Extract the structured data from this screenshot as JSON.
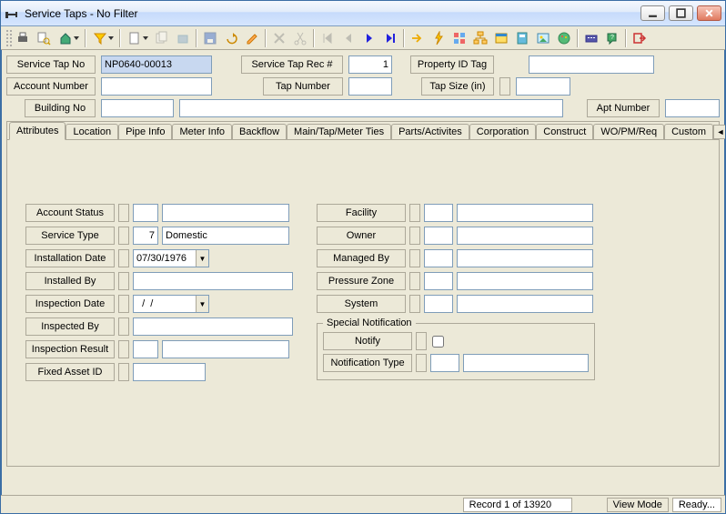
{
  "window": {
    "title": "Service Taps - No Filter"
  },
  "toprow": {
    "service_tap_no_label": "Service Tap No",
    "service_tap_no_value": "NP0640-00013",
    "service_tap_rec_label": "Service Tap Rec #",
    "service_tap_rec_value": "1",
    "property_id_tag_label": "Property ID Tag",
    "property_id_tag_value": "",
    "account_number_label": "Account Number",
    "account_number_value": "",
    "tap_number_label": "Tap Number",
    "tap_number_value": "",
    "tap_size_label": "Tap Size (in)",
    "tap_size_value": "",
    "building_no_label": "Building No",
    "building_no_value": "",
    "building_desc_value": "",
    "apt_number_label": "Apt Number",
    "apt_number_value": ""
  },
  "tabs": {
    "items": [
      "Attributes",
      "Location",
      "Pipe Info",
      "Meter Info",
      "Backflow",
      "Main/Tap/Meter Ties",
      "Parts/Activites",
      "Corporation",
      "Construct",
      "WO/PM/Req",
      "Custom"
    ],
    "active_index": 0
  },
  "attributes": {
    "account_status_label": "Account Status",
    "account_status_code": "",
    "account_status_desc": "",
    "service_type_label": "Service Type",
    "service_type_code": "7",
    "service_type_desc": "Domestic",
    "installation_date_label": "Installation Date",
    "installation_date_value": "07/30/1976",
    "installed_by_label": "Installed By",
    "installed_by_value": "",
    "inspection_date_label": "Inspection Date",
    "inspection_date_value": "  /  /",
    "inspected_by_label": "Inspected By",
    "inspected_by_value": "",
    "inspection_result_label": "Inspection Result",
    "inspection_result_code": "",
    "inspection_result_desc": "",
    "fixed_asset_id_label": "Fixed Asset ID",
    "fixed_asset_id_value": "",
    "facility_label": "Facility",
    "facility_code": "",
    "facility_desc": "",
    "owner_label": "Owner",
    "owner_code": "",
    "owner_desc": "",
    "managed_by_label": "Managed By",
    "managed_by_code": "",
    "managed_by_desc": "",
    "pressure_zone_label": "Pressure Zone",
    "pressure_zone_code": "",
    "pressure_zone_desc": "",
    "system_label": "System",
    "system_code": "",
    "system_desc": "",
    "special_legend": "Special Notification",
    "notify_label": "Notify",
    "notify_checked": false,
    "notification_type_label": "Notification Type",
    "notification_type_code": "",
    "notification_type_desc": ""
  },
  "status": {
    "record": "Record 1 of 13920",
    "mode": "View Mode",
    "ready": "Ready..."
  }
}
